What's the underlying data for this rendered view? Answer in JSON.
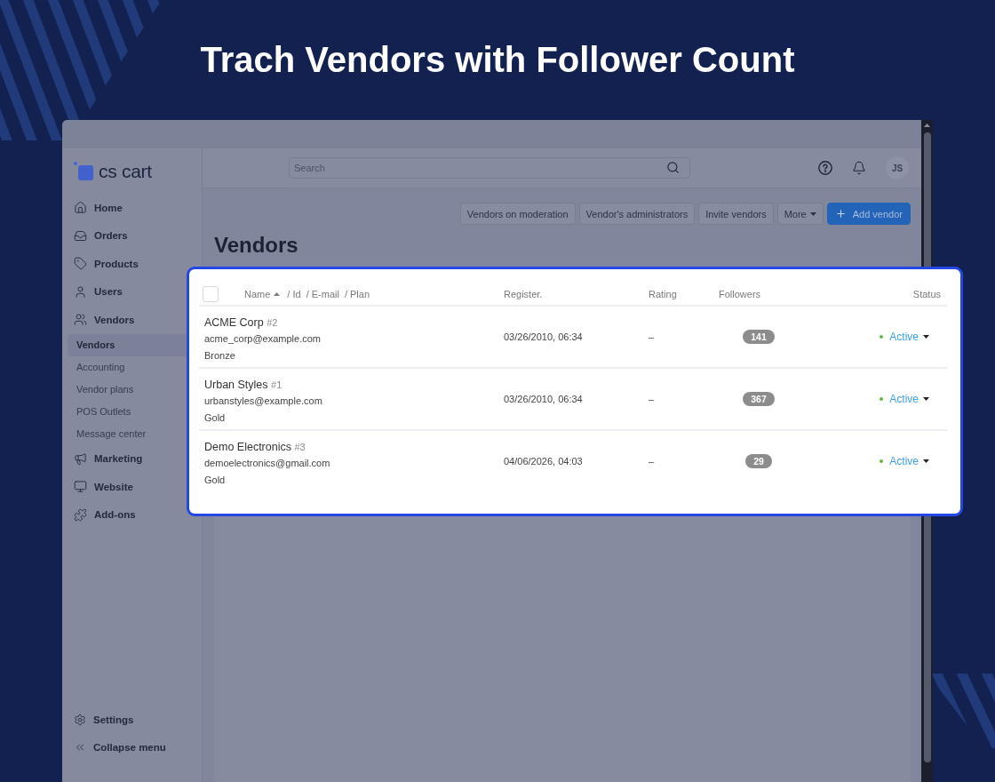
{
  "headline": "Trach Vendors with Follower Count",
  "sidebar": {
    "logo": "cs cart",
    "items": [
      {
        "label": "Home",
        "selected": false
      },
      {
        "label": "Orders",
        "selected": false
      },
      {
        "label": "Products",
        "selected": false
      },
      {
        "label": "Users",
        "selected": false
      },
      {
        "label": "Vendors",
        "selected": false,
        "children": [
          {
            "label": "Vendors",
            "selected": true
          },
          {
            "label": "Accounting",
            "selected": false
          },
          {
            "label": "Vendor plans",
            "selected": false
          },
          {
            "label": "POS Outlets",
            "selected": false
          },
          {
            "label": "Message center",
            "selected": false
          }
        ]
      },
      {
        "label": "Marketing",
        "selected": false
      },
      {
        "label": "Website",
        "selected": false
      },
      {
        "label": "Add-ons",
        "selected": false
      }
    ],
    "footer": [
      {
        "label": "Settings"
      },
      {
        "label": "Collapse menu"
      }
    ]
  },
  "header": {
    "search": {
      "placeholder": "Search"
    },
    "avatar": "JS"
  },
  "toolbar": {
    "buttons": [
      {
        "label": "Vendors on moderation",
        "kind": "default"
      },
      {
        "label": "Vendor's administrators",
        "kind": "default"
      },
      {
        "label": "Invite vendors",
        "kind": "default"
      },
      {
        "label": "More",
        "kind": "dropdown"
      },
      {
        "label": "Add vendor",
        "kind": "primary"
      }
    ]
  },
  "page_title": "Vendors",
  "table": {
    "select_all": {
      "checked": false
    },
    "name_columns": [
      {
        "label": "Name",
        "sorted": true
      },
      {
        "label": "/ Id"
      },
      {
        "label": "/ E-mail"
      },
      {
        "label": "/ Plan"
      }
    ],
    "columns": [
      {
        "label": "Register."
      },
      {
        "label": "Rating"
      },
      {
        "label": "Followers"
      },
      {
        "label": "Status"
      }
    ],
    "rows": [
      {
        "name": "ACME Corp #2",
        "email": "acme_corp@example.com",
        "plan": "Bronze",
        "registered": "03/26/2010, 06:34",
        "rating": "–",
        "followers": "141",
        "status": {
          "label": "Active",
          "color": "#62b843"
        }
      },
      {
        "name": "Urban Styles #1",
        "email": "urbanstyles@example.com",
        "plan": "Gold",
        "registered": "03/26/2010, 06:34",
        "rating": "–",
        "followers": "367",
        "status": {
          "label": "Active",
          "color": "#62b843"
        }
      },
      {
        "name": "Demo Electronics #3",
        "email": "demoelectronics@gmail.com",
        "plan": "Gold",
        "registered": "04/06/2026, 04:03",
        "rating": "–",
        "followers": "29",
        "status": {
          "label": "Active",
          "color": "#62b843"
        }
      }
    ]
  }
}
